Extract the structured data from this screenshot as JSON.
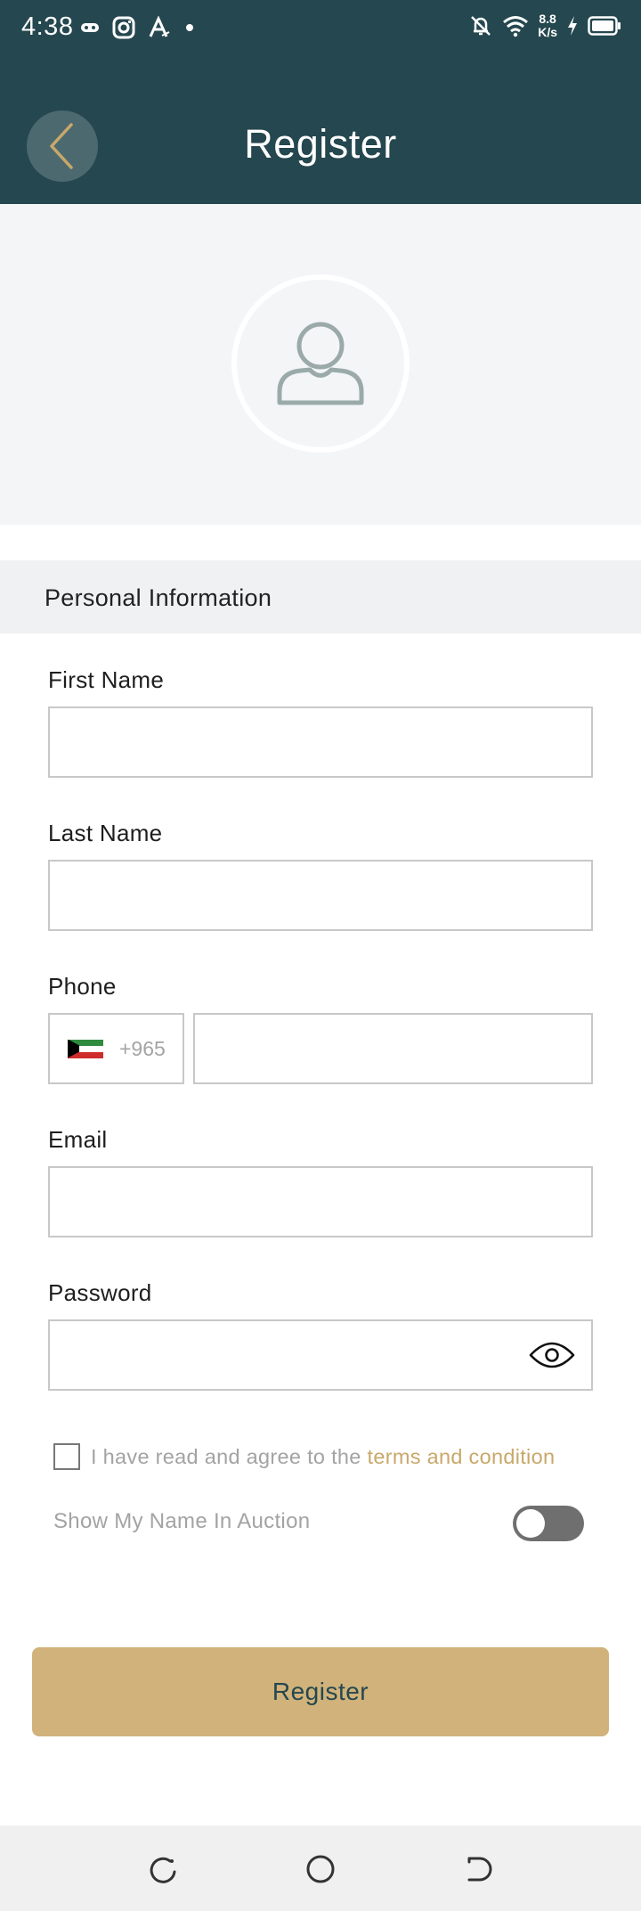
{
  "status_bar": {
    "time": "4:38",
    "net_speed_value": "8.8",
    "net_speed_unit": "K/s",
    "icons": [
      "gamepad-icon",
      "instagram-icon",
      "font-a-icon",
      "dot-icon",
      "mute-bell-icon",
      "wifi-icon",
      "charging-icon",
      "battery-icon"
    ]
  },
  "header": {
    "title": "Register",
    "back_icon": "chevron-left-icon"
  },
  "avatar": {
    "icon": "user-placeholder-icon"
  },
  "section": {
    "title": "Personal Information"
  },
  "form": {
    "first_name": {
      "label": "First Name",
      "value": ""
    },
    "last_name": {
      "label": "Last Name",
      "value": ""
    },
    "phone": {
      "label": "Phone",
      "dial_code": "+965",
      "flag": "kuwait-flag",
      "value": ""
    },
    "email": {
      "label": "Email",
      "value": ""
    },
    "password": {
      "label": "Password",
      "value": "",
      "toggle_icon": "eye-icon"
    },
    "agree": {
      "text": "I have read and agree to the",
      "link": "terms and condition",
      "checked": false
    },
    "show_name": {
      "label": "Show My Name In Auction",
      "enabled": false
    }
  },
  "register_button": {
    "label": "Register"
  },
  "nav_bar": {
    "icons": [
      "recents-icon",
      "home-icon",
      "back-icon"
    ]
  },
  "colors": {
    "header_bg": "#25474f",
    "accent": "#d0b27a",
    "link": "#c8a86a",
    "avatar_area_bg": "#f4f5f7"
  }
}
